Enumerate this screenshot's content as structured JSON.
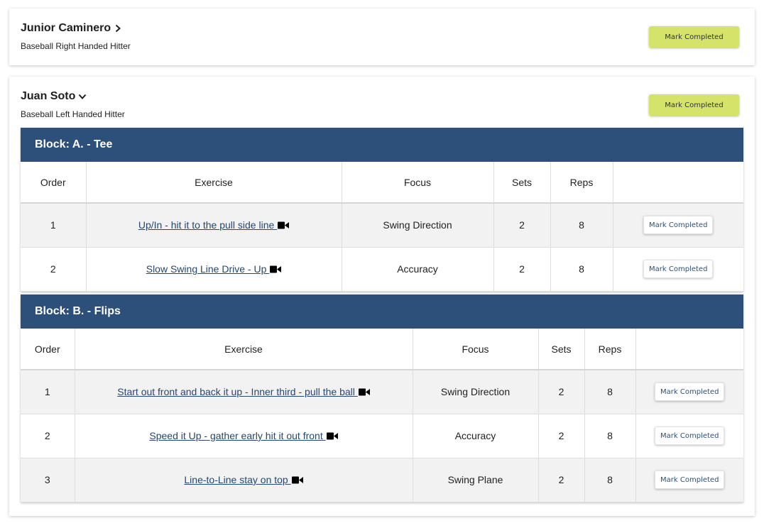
{
  "athletes": [
    {
      "name": "Junior Caminero",
      "subtitle": "Baseball Right Handed Hitter",
      "expanded": false,
      "mark_label": "Mark Completed"
    },
    {
      "name": "Juan Soto",
      "subtitle": "Baseball Left Handed Hitter",
      "expanded": true,
      "mark_label": "Mark Completed",
      "blocks": [
        {
          "title": "Block: A. - Tee",
          "columns": [
            "Order",
            "Exercise",
            "Focus",
            "Sets",
            "Reps",
            ""
          ],
          "rows": [
            {
              "order": "1",
              "exercise": "Up/In - hit it to the pull side line ",
              "focus": "Swing Direction",
              "sets": "2",
              "reps": "8",
              "action": "Mark Completed"
            },
            {
              "order": "2",
              "exercise": "Slow Swing Line Drive - Up ",
              "focus": "Accuracy",
              "sets": "2",
              "reps": "8",
              "action": "Mark Completed"
            }
          ]
        },
        {
          "title": "Block: B. - Flips",
          "columns": [
            "Order",
            "Exercise",
            "Focus",
            "Sets",
            "Reps",
            ""
          ],
          "rows": [
            {
              "order": "1",
              "exercise": "Start out front and back it up - Inner third - pull the ball ",
              "focus": "Swing Direction",
              "sets": "2",
              "reps": "8",
              "action": "Mark Completed"
            },
            {
              "order": "2",
              "exercise": "Speed it Up - gather early hit it out front ",
              "focus": "Accuracy",
              "sets": "2",
              "reps": "8",
              "action": "Mark Completed"
            },
            {
              "order": "3",
              "exercise": "Line-to-Line stay on top ",
              "focus": "Swing Plane",
              "sets": "2",
              "reps": "8",
              "action": "Mark Completed"
            }
          ]
        }
      ]
    }
  ],
  "icons": {
    "collapsed": "chevron-right-icon",
    "expanded": "chevron-down-icon",
    "video": "video-camera-icon"
  },
  "colors": {
    "block_header": "#2c5079",
    "lime_button": "#d6e36a",
    "link": "#24486f"
  }
}
